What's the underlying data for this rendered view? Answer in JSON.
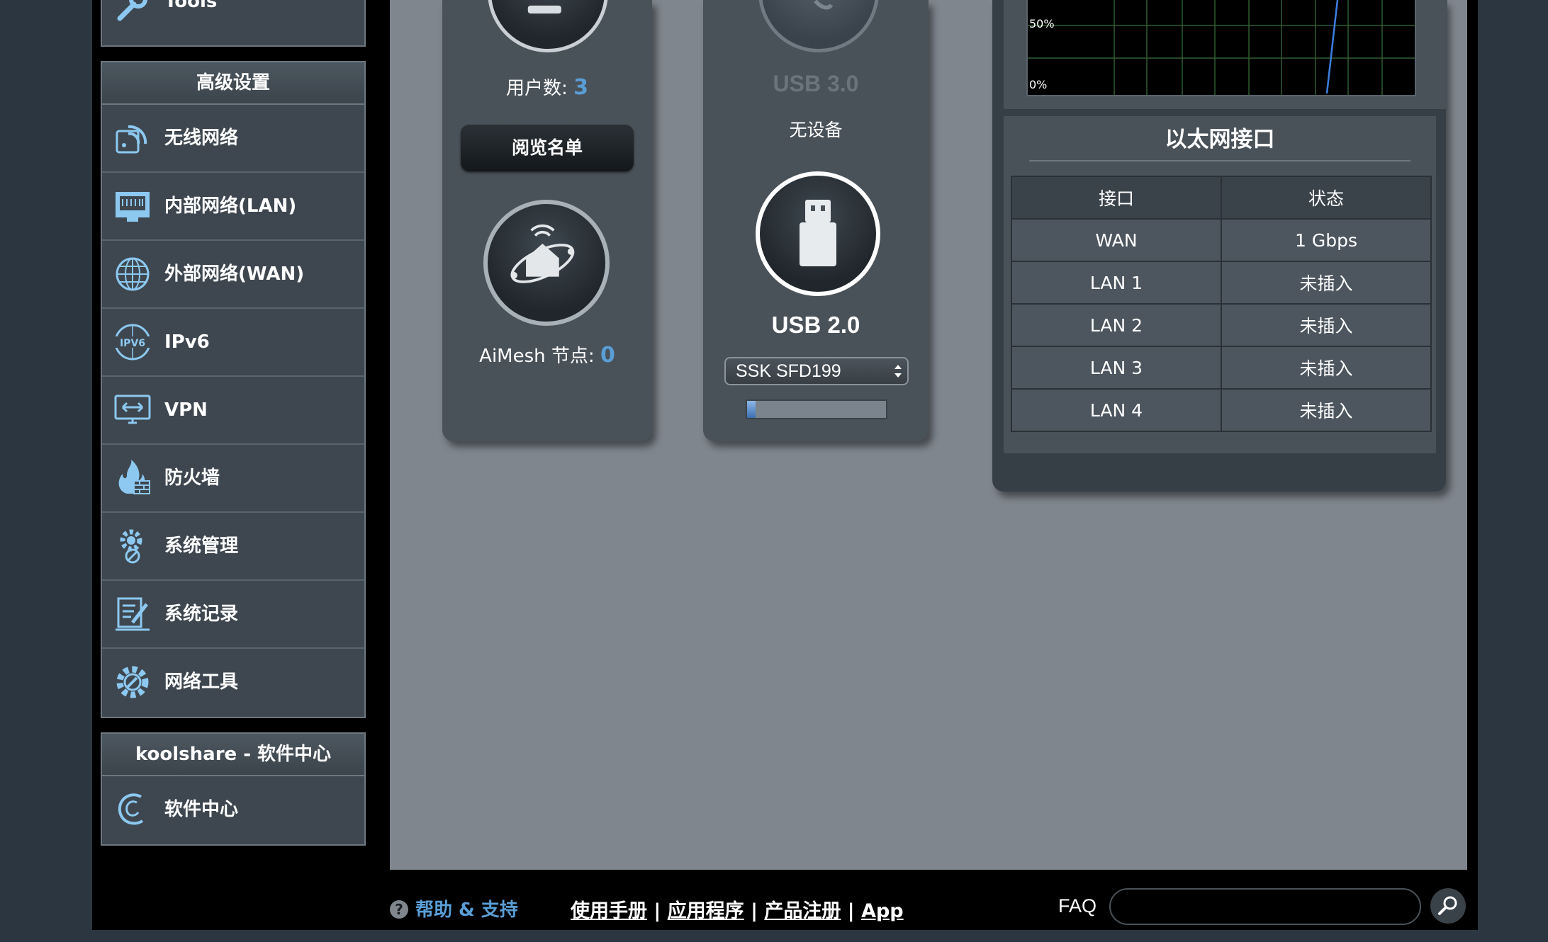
{
  "sidebar": {
    "tools_label": "Tools",
    "advanced": {
      "title": "高级设置",
      "items": [
        {
          "label": "无线网络",
          "icon": "wireless-icon"
        },
        {
          "label": "内部网络(LAN)",
          "icon": "lan-icon"
        },
        {
          "label": "外部网络(WAN)",
          "icon": "wan-globe-icon"
        },
        {
          "label": "IPv6",
          "icon": "ipv6-icon"
        },
        {
          "label": "VPN",
          "icon": "vpn-icon"
        },
        {
          "label": "防火墙",
          "icon": "firewall-icon"
        },
        {
          "label": "系统管理",
          "icon": "admin-gear-icon"
        },
        {
          "label": "系统记录",
          "icon": "log-icon"
        },
        {
          "label": "网络工具",
          "icon": "network-tools-icon"
        }
      ]
    },
    "software": {
      "title": "koolshare - 软件中心",
      "items": [
        {
          "label": "软件中心",
          "icon": "software-center-icon"
        }
      ]
    }
  },
  "clients": {
    "count_label": "用户数:",
    "count": "3",
    "view_list_button": "阅览名单",
    "aimesh_label": "AiMesh 节点:",
    "aimesh_count": "0"
  },
  "usb": {
    "usb3_label": "USB 3.0",
    "usb3_status": "无设备",
    "usb2_label": "USB 2.0",
    "usb2_device": "SSK SFD199",
    "usb2_usage": 0.06
  },
  "cpu_chart": {
    "label_50": "50%",
    "label_0": "0%"
  },
  "ethernet": {
    "title": "以太网接口",
    "headers": [
      "接口",
      "状态"
    ],
    "rows": [
      [
        "WAN",
        "1 Gbps"
      ],
      [
        "LAN 1",
        "未插入"
      ],
      [
        "LAN 2",
        "未插入"
      ],
      [
        "LAN 3",
        "未插入"
      ],
      [
        "LAN 4",
        "未插入"
      ]
    ]
  },
  "footer": {
    "help_label": "帮助 & 支持",
    "links": [
      "使用手册",
      "应用程序",
      "产品注册",
      "App"
    ],
    "separator": "|",
    "faq_label": "FAQ",
    "search_placeholder": ""
  },
  "colors": {
    "accent_blue": "#5a9ed6",
    "icon_blue": "#8cc8f0"
  }
}
